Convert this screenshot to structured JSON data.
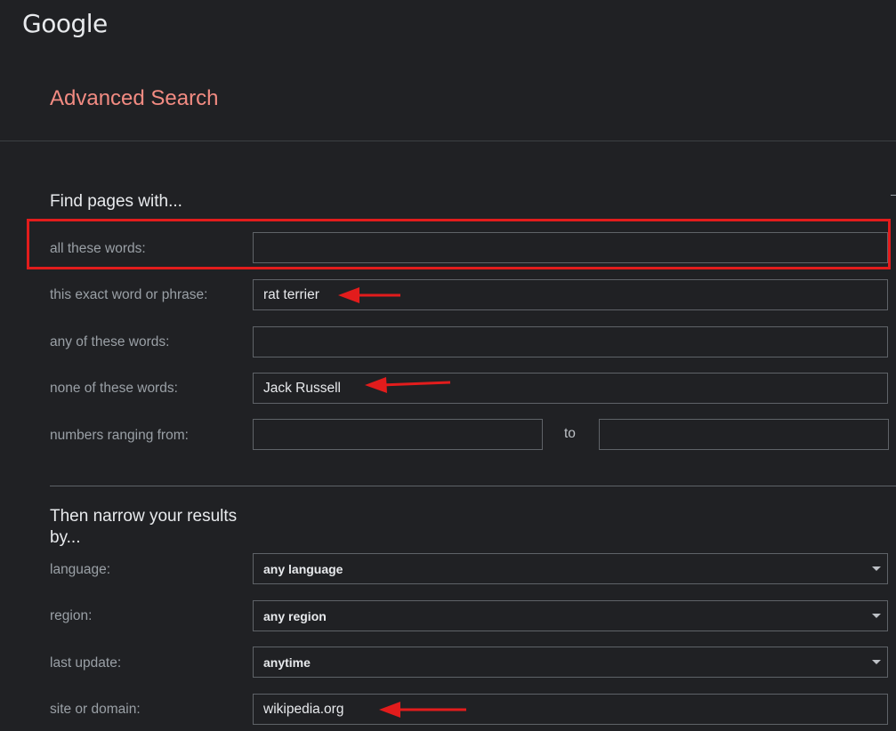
{
  "brand": {
    "logo_text": "Google"
  },
  "page": {
    "title": "Advanced Search"
  },
  "find_section": {
    "title": "Find pages with...",
    "rows": [
      {
        "label": "all these words:",
        "value": ""
      },
      {
        "label": "this exact word or phrase:",
        "value": "rat terrier"
      },
      {
        "label": "any of these words:",
        "value": ""
      },
      {
        "label": "none of these words:",
        "value": "Jack Russell"
      }
    ],
    "numbers": {
      "label": "numbers ranging from:",
      "from_value": "",
      "to_label": "to",
      "to_value": ""
    }
  },
  "narrow_section": {
    "title": "Then narrow your results by...",
    "language": {
      "label": "language:",
      "selected": "any language"
    },
    "region": {
      "label": "region:",
      "selected": "any region"
    },
    "last_update": {
      "label": "last update:",
      "selected": "anytime"
    },
    "site": {
      "label": "site or domain:",
      "value": "wikipedia.org"
    }
  },
  "annotations": {
    "highlight_color": "#e21c1c",
    "arrow_color": "#e21c1c",
    "highlighted_row": "all these words:"
  },
  "colors": {
    "background": "#202124",
    "title_accent": "#f28b82",
    "field_border": "#5f6368"
  }
}
